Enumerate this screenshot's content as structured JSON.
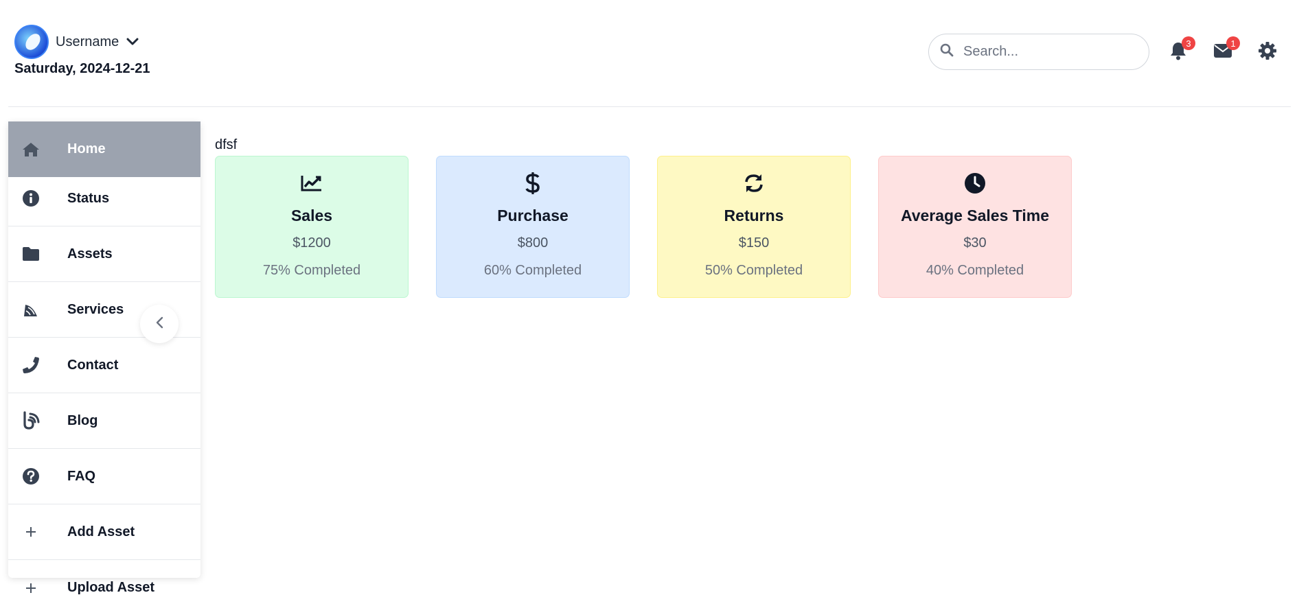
{
  "header": {
    "username": "Username",
    "date": "Saturday, 2024-12-21",
    "search_placeholder": "Search...",
    "notifications_count": "3",
    "messages_count": "1",
    "icons": [
      "chevron-down-icon",
      "search-icon",
      "bell-icon",
      "envelope-icon",
      "gear-icon"
    ]
  },
  "sidebar": {
    "items": [
      {
        "label": "Home",
        "icon": "home-icon",
        "active": true
      },
      {
        "label": "Status",
        "icon": "info-icon"
      },
      {
        "label": "Assets",
        "icon": "folder-icon"
      },
      {
        "label": "Services",
        "icon": "satellite-dish-icon"
      },
      {
        "label": "Contact",
        "icon": "phone-icon"
      },
      {
        "label": "Blog",
        "icon": "blog-icon"
      },
      {
        "label": "FAQ",
        "icon": "question-icon"
      },
      {
        "label": "Add Asset",
        "icon": "plus-icon"
      },
      {
        "label": "Upload Asset",
        "icon": "plus-icon"
      }
    ],
    "collapse_icon": "chevron-left-icon"
  },
  "main": {
    "title": "dfsf",
    "cards": [
      {
        "title": "Sales",
        "value": "$1200",
        "progress": "75% Completed",
        "progress_value": 0.75,
        "icon": "chart-line-icon",
        "bg": "#dcfce7",
        "border": "#bbf7d0"
      },
      {
        "title": "Purchase",
        "value": "$800",
        "progress": "60% Completed",
        "progress_value": 0.6,
        "icon": "dollar-icon",
        "bg": "#dbeafe",
        "border": "#bfdbfe"
      },
      {
        "title": "Returns",
        "value": "$150",
        "progress": "50% Completed",
        "progress_value": 0.5,
        "icon": "sync-icon",
        "bg": "#fef9c3",
        "border": "#fef08a"
      },
      {
        "title": "Average Sales Time",
        "value": "$30",
        "progress": "40% Completed",
        "progress_value": 0.4,
        "icon": "clock-icon",
        "bg": "#fee2e2",
        "border": "#fecaca"
      }
    ]
  }
}
